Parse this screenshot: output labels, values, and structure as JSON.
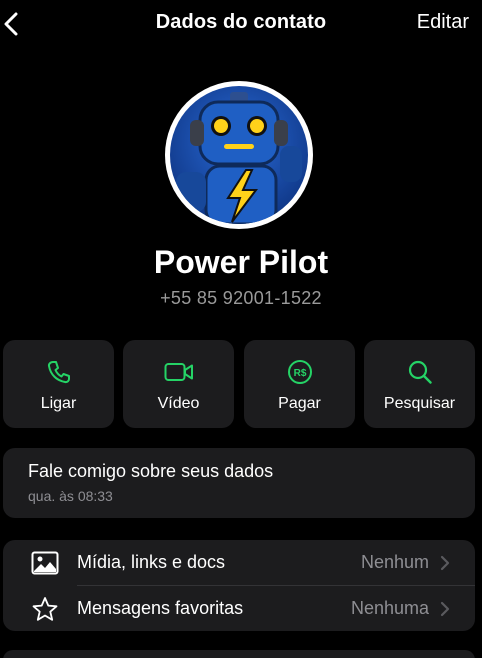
{
  "nav": {
    "title": "Dados do contato",
    "edit_label": "Editar",
    "back_icon": "chevron-left-icon"
  },
  "contact": {
    "name": "Power Pilot",
    "phone": "+55 85 92001-1522"
  },
  "actions": [
    {
      "label": "Ligar",
      "icon": "phone-icon"
    },
    {
      "label": "Vídeo",
      "icon": "video-icon"
    },
    {
      "label": "Pagar",
      "icon": "pay-icon"
    },
    {
      "label": "Pesquisar",
      "icon": "search-icon"
    }
  ],
  "status": {
    "text": "Fale comigo sobre seus dados",
    "time": "qua. às 08:33"
  },
  "list": [
    {
      "label": "Mídia, links e docs",
      "value": "Nenhum",
      "icon": "image-icon"
    },
    {
      "label": "Mensagens favoritas",
      "value": "Nenhuma",
      "icon": "star-icon"
    }
  ],
  "colors": {
    "accent": "#25d366",
    "background": "#000000",
    "card": "#1c1c1e",
    "secondary_text": "#8e8e93"
  }
}
